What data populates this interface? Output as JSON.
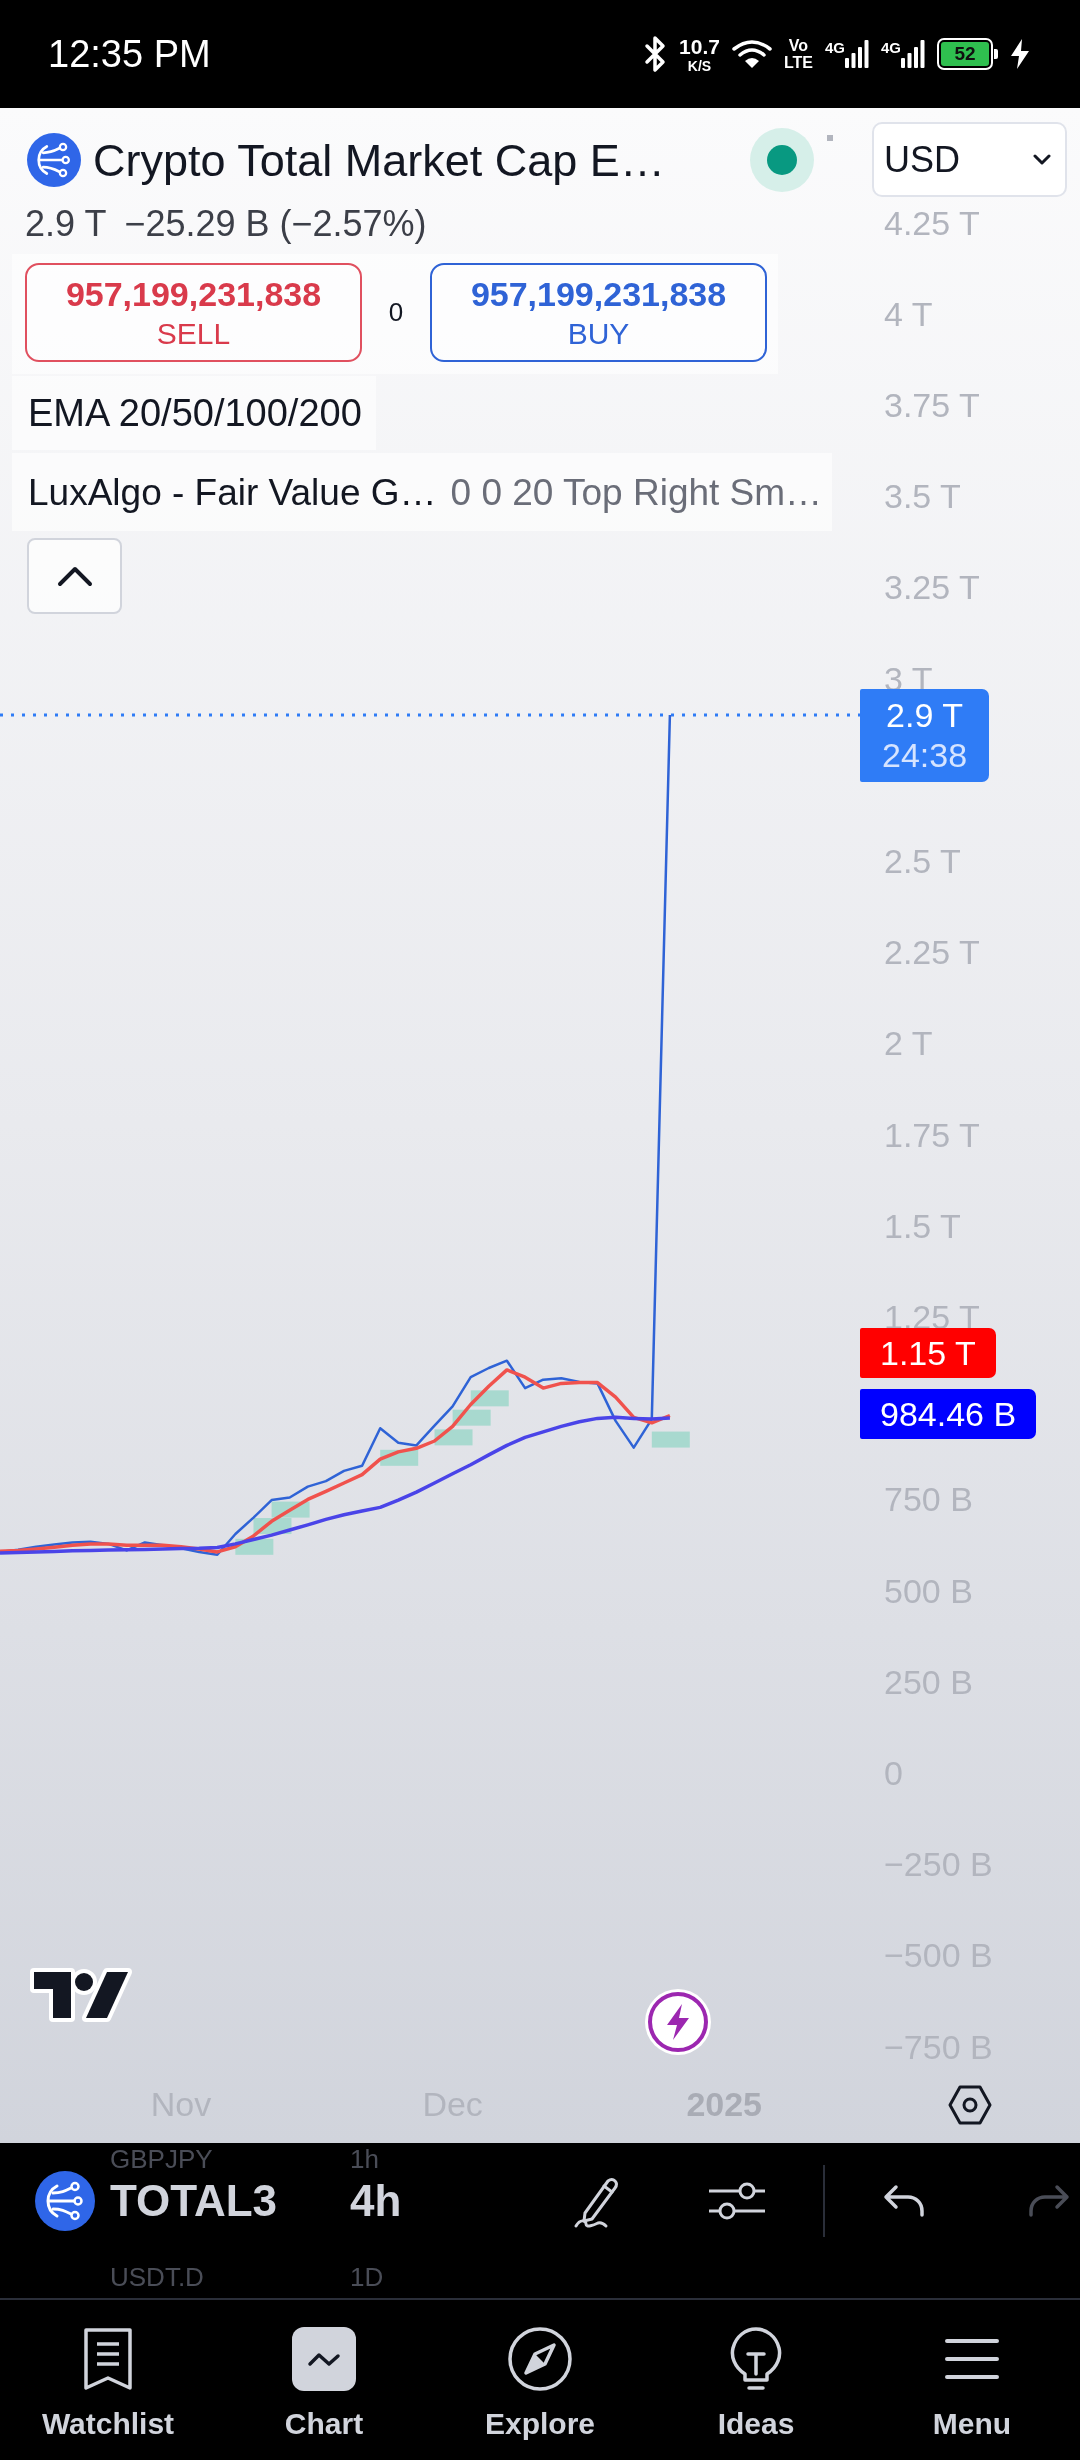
{
  "status_bar": {
    "time": "12:35 PM",
    "net_speed": "10.7",
    "net_speed_unit": "K/S",
    "volte": "Vo",
    "volte_sub": "LTE",
    "signals": [
      {
        "network": "4G"
      },
      {
        "network": "4G"
      }
    ],
    "battery": "52"
  },
  "header": {
    "title": "Crypto Total Market Cap E…",
    "currency": "USD"
  },
  "legend": {
    "last_price": "2.9 T",
    "change": "−25.29 B (−2.57%)",
    "sell": {
      "price": "957,199,231,838",
      "label": "SELL"
    },
    "spread": "0",
    "buy": {
      "price": "957,199,231,838",
      "label": "BUY"
    },
    "indicators": [
      {
        "name": "EMA 20/50/100/200"
      },
      {
        "name": "LuxAlgo - Fair Value G…",
        "params": "0 0 20 Top Right Sm…"
      }
    ]
  },
  "chart": {
    "chart_data": {
      "type": "line",
      "categories": [
        null,
        null,
        null,
        null,
        null,
        null,
        null,
        null,
        null,
        null,
        "Nov",
        null,
        null,
        null,
        null,
        null,
        null,
        null,
        null,
        null,
        null,
        null,
        null,
        null,
        null,
        "Dec",
        null,
        null,
        null,
        null,
        null,
        null,
        null,
        null,
        null,
        null,
        null,
        null,
        null,
        null,
        "2025",
        null,
        null,
        null,
        null,
        null,
        null,
        null
      ],
      "series": [
        {
          "color": "#2f63d6",
          "values": [
            606000000000.0,
            612000000000.0,
            620000000000.0,
            626000000000.0,
            632000000000.0,
            634000000000.0,
            628000000000.0,
            610000000000.0,
            632000000000.0,
            624000000000.0,
            616000000000.0,
            606000000000.0,
            598000000000.0,
            655000000000.0,
            700000000000.0,
            748000000000.0,
            755000000000.0,
            785000000000.0,
            800000000000.0,
            828000000000.0,
            842000000000.0,
            945000000000.0,
            905000000000.0,
            898000000000.0,
            952000000000.0,
            1005000000000.0,
            1085000000000.0,
            1110000000000.0,
            1130000000000.0,
            1055000000000.0,
            1078000000000.0,
            1082000000000.0,
            1072000000000.0,
            1068000000000.0,
            965000000000.0,
            892000000000.0,
            970000000000.0,
            2900000000000.0,
            null,
            null,
            null,
            null,
            null,
            null,
            null,
            null,
            null,
            null
          ]
        },
        {
          "color": "#f0524d",
          "values": [
            608000000000.0,
            610000000000.0,
            614000000000.0,
            619000000000.0,
            624000000000.0,
            628000000000.0,
            628000000000.0,
            624000000000.0,
            624000000000.0,
            624000000000.0,
            620000000000.0,
            614000000000.0,
            606000000000.0,
            620000000000.0,
            650000000000.0,
            690000000000.0,
            720000000000.0,
            750000000000.0,
            772000000000.0,
            795000000000.0,
            818000000000.0,
            860000000000.0,
            880000000000.0,
            890000000000.0,
            910000000000.0,
            950000000000.0,
            1010000000000.0,
            1060000000000.0,
            1105000000000.0,
            1085000000000.0,
            1055000000000.0,
            1068000000000.0,
            1070000000000.0,
            1070000000000.0,
            1030000000000.0,
            975000000000.0,
            960000000000.0,
            980000000000.0,
            null,
            null,
            null,
            null,
            null,
            null,
            null,
            null,
            null,
            null
          ]
        },
        {
          "color": "#4a44e8",
          "values": [
            603000000000.0,
            604000000000.0,
            606000000000.0,
            607000000000.0,
            609000000000.0,
            610000000000.0,
            611000000000.0,
            612000000000.0,
            613000000000.0,
            614000000000.0,
            615000000000.0,
            616000000000.0,
            618000000000.0,
            628000000000.0,
            640000000000.0,
            652000000000.0,
            666000000000.0,
            680000000000.0,
            695000000000.0,
            708000000000.0,
            718000000000.0,
            728000000000.0,
            748000000000.0,
            770000000000.0,
            795000000000.0,
            820000000000.0,
            845000000000.0,
            872000000000.0,
            898000000000.0,
            920000000000.0,
            935000000000.0,
            950000000000.0,
            963000000000.0,
            972000000000.0,
            975000000000.0,
            972000000000.0,
            970000000000.0,
            973000000000.0,
            null,
            null,
            null,
            null,
            null,
            null,
            null,
            null,
            null,
            null
          ]
        }
      ],
      "ylim": [
        -750000000000.0,
        4250000000000.0
      ],
      "yticks": [
        {
          "value": 4250000000000.0,
          "label": "4.25 T"
        },
        {
          "value": 4000000000000.0,
          "label": "4 T"
        },
        {
          "value": 3750000000000.0,
          "label": "3.75 T"
        },
        {
          "value": 3500000000000.0,
          "label": "3.5 T"
        },
        {
          "value": 3250000000000.0,
          "label": "3.25 T"
        },
        {
          "value": 3000000000000.0,
          "label": "3 T"
        },
        {
          "value": 2500000000000.0,
          "label": "2.5 T"
        },
        {
          "value": 2250000000000.0,
          "label": "2.25 T"
        },
        {
          "value": 2000000000000.0,
          "label": "2 T"
        },
        {
          "value": 1750000000000.0,
          "label": "1.75 T"
        },
        {
          "value": 1500000000000.0,
          "label": "1.5 T"
        },
        {
          "value": 1250000000000.0,
          "label": "1.25 T"
        },
        {
          "value": 750000000000.0,
          "label": "750 B"
        },
        {
          "value": 500000000000.0,
          "label": "500 B"
        },
        {
          "value": 250000000000.0,
          "label": "250 B"
        },
        0,
        {
          "value": -250000000000.0,
          "label": "−250 B"
        },
        {
          "value": -500000000000.0,
          "label": "−500 B"
        },
        {
          "value": -750000000000.0,
          "label": "−750 B"
        }
      ]
    },
    "price_tags": [
      {
        "price": "2.9 T",
        "countdown": "24:38",
        "color": "#2f7cf6"
      },
      {
        "price": "1.15 T",
        "color": "#ff0000"
      },
      {
        "price": "984.46 B",
        "color": "#0000ff"
      }
    ]
  },
  "toolbar": {
    "symbols": [
      {
        "symbol": "GBPJPY",
        "interval": "1h",
        "selected": false
      },
      {
        "symbol": "TOTAL3",
        "interval": "4h",
        "selected": true
      },
      {
        "symbol": "USDT.D",
        "interval": "1D",
        "selected": false
      }
    ],
    "undo": {
      "disabled": false
    },
    "redo": {
      "disabled": true
    }
  },
  "nav": {
    "items": [
      {
        "label": "Watchlist",
        "selected": false
      },
      {
        "label": "Chart",
        "selected": true
      },
      {
        "label": "Explore",
        "selected": false
      },
      {
        "label": "Ideas",
        "selected": false
      },
      {
        "label": "Menu",
        "selected": false
      }
    ]
  }
}
